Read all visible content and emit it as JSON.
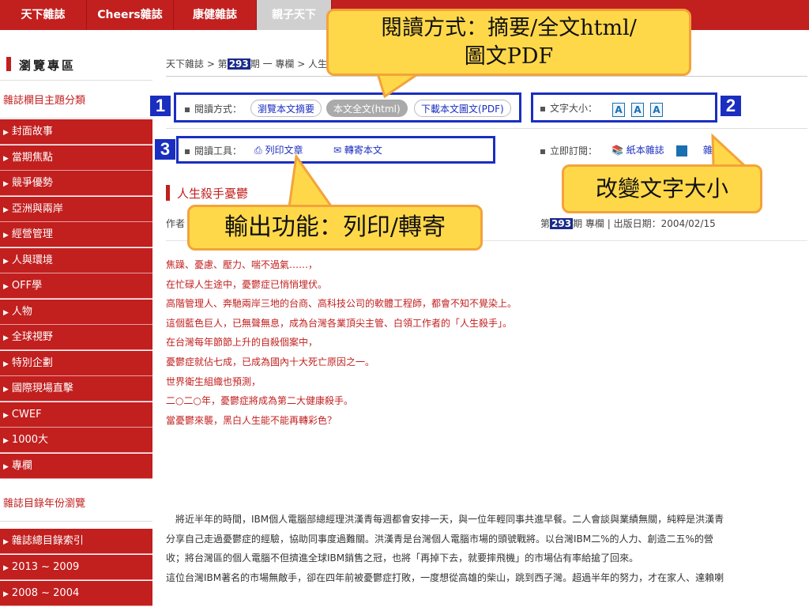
{
  "topnav": {
    "tabs": [
      "天下雜誌",
      "Cheers雜誌",
      "康健雜誌",
      "親子天下"
    ]
  },
  "sidebar": {
    "title": "瀏覽專區",
    "section1": "雜誌欄目主題分類",
    "items": [
      "封面故事",
      "當期焦點",
      "競爭優勢",
      "亞洲與兩岸",
      "經營管理",
      "人與環境",
      "OFF學",
      "人物",
      "全球視野",
      "特別企劃",
      "國際現場直擊",
      "CWEF",
      "1000大",
      "專欄"
    ],
    "section2": "雜誌目錄年份瀏覽",
    "items2": [
      "雜誌總目錄索引",
      "2013 ~ 2009",
      "2008 ~ 2004"
    ]
  },
  "breadcrumb": {
    "prefix": "天下雜誌 > 第",
    "issue": "293",
    "suffix": "期 一 專欄 > 人生"
  },
  "toolbar": {
    "read_mode_label": "閱讀方式：",
    "read_summary": "瀏覽本文摘要",
    "read_full_html": "本文全文(html)",
    "read_pdf": "下載本文圖文(PDF)",
    "font_size_label": "文字大小：",
    "font_sizes": [
      "A",
      "A",
      "A"
    ],
    "tools_label": "閱讀工具：",
    "print": "列印文章",
    "forward": "轉寄本文",
    "subscribe_label": "立即訂閱：",
    "paper_mag": "紙本雜誌",
    "digital_mag_tail": "雜誌"
  },
  "badges": [
    "1",
    "2",
    "3"
  ],
  "article": {
    "title": "人生殺手憂鬱",
    "author_prefix": "作者",
    "meta_prefix": "第",
    "meta_issue": "293",
    "meta_suffix": "期 專欄 | 出版日期：2004/02/15",
    "lead": [
      "焦躁、憂慮、壓力、喘不過氣……，",
      "在忙碌人生途中，憂鬱症已悄悄埋伏。",
      "高階管理人、奔馳兩岸三地的台商、高科技公司的軟體工程師，都會不知不覺染上。",
      "這個藍色巨人，已無聲無息，成為台灣各業頂尖主管、白領工作者的「人生殺手」。",
      "在台灣每年節節上升的自殺個案中，",
      "憂鬱症就佔七成，已成為國內十大死亡原因之一。",
      "世界衛生組織也預測，",
      "二○二○年，憂鬱症將成為第二大健康殺手。",
      "當憂鬱來襲，黑白人生能不能再轉彩色？"
    ],
    "body": [
      "　將近半年的時間，IBM個人電腦部總經理洪漢青每週都會安排一天，與一位年輕同事共進早餐。二人會談與業績無關，純粹是洪漢青",
      "分享自己走過憂鬱症的經驗，協助同事度過難關。洪漢青是台灣個人電腦市場的頭號戰將。以台灣IBM二%的人力、創造二五%的營",
      "收；將台灣區的個人電腦不但擠進全球IBM銷售之冠，也將「再掉下去，就要摔飛機」的市場佔有率給搶了回來。",
      "這位台灣IBM著名的市場無敵手，卻在四年前被憂鬱症打敗，一度想從高雄的柴山，跳到西子灣。超過半年的努力，才在家人、達賴喇"
    ]
  },
  "callouts": {
    "c1_line1": "閱讀方式：摘要/全文html/",
    "c1_line2": "圖文PDF",
    "c2": "改變文字大小",
    "c3": "輸出功能：列印/轉寄"
  }
}
